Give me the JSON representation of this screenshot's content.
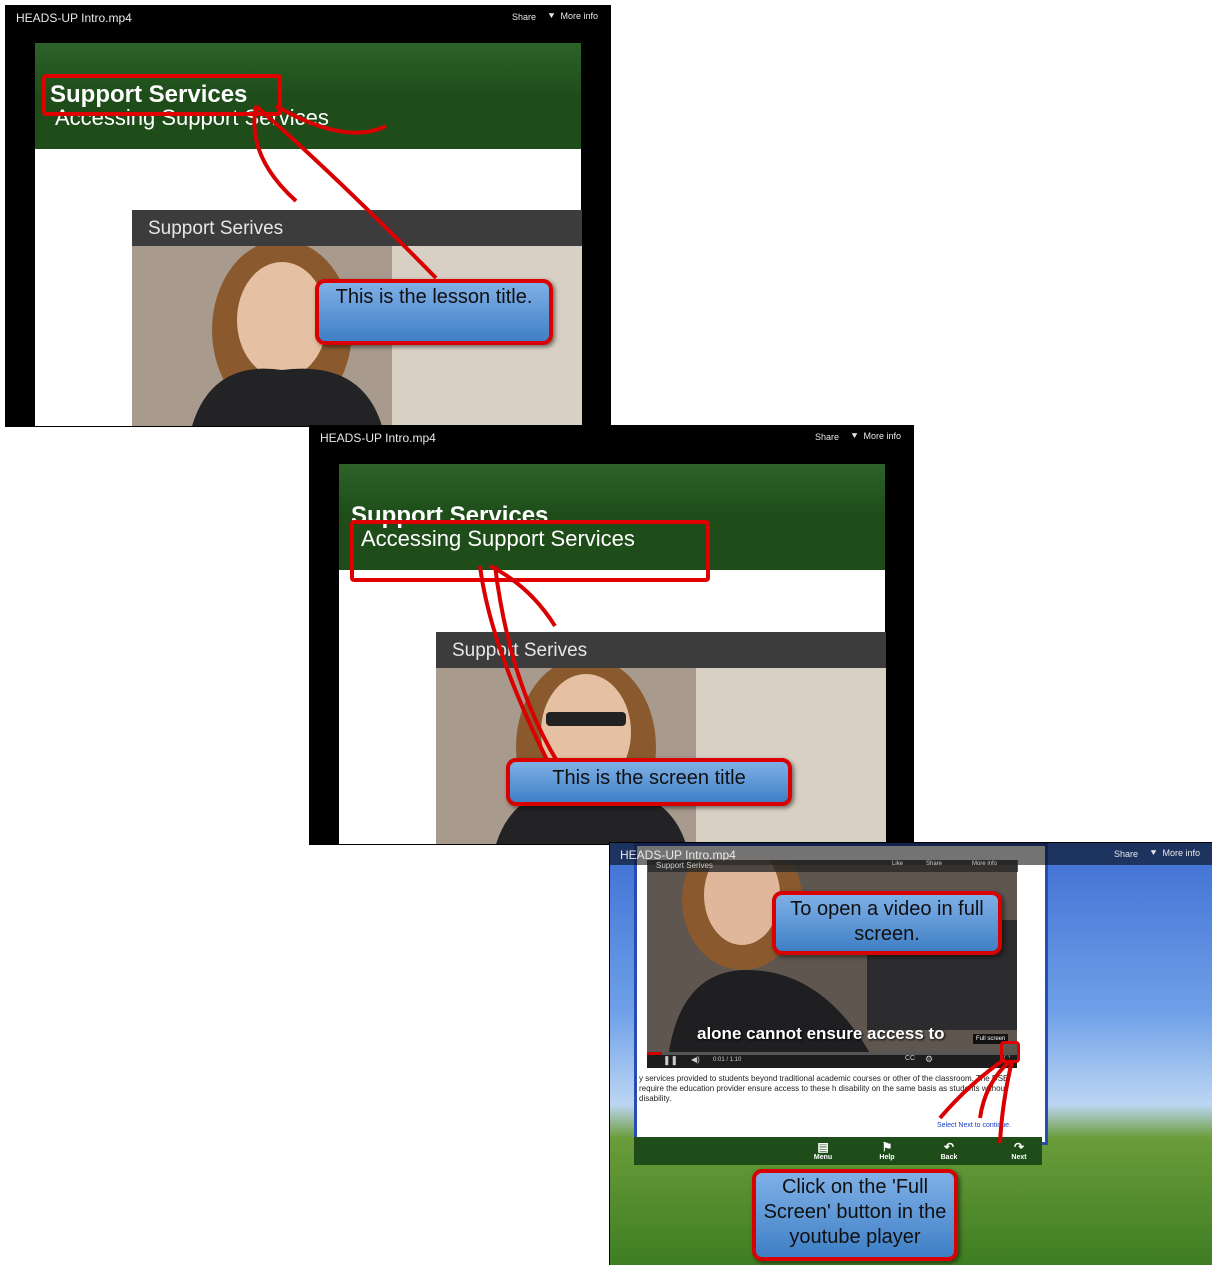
{
  "player": {
    "file_title": "HEADS-UP Intro.mp4",
    "share_label": "Share",
    "more_info_label": "More info"
  },
  "slide": {
    "lesson_title": "Support Services",
    "screen_title": "Accessing Support Services",
    "video_title": "Support Serives"
  },
  "callouts": {
    "lesson": "This is the lesson title.",
    "screen": "This is the screen title",
    "open_fullscreen": "To open a video in full screen.",
    "click_fullscreen": "Click on the 'Full Screen' button in the youtube player"
  },
  "youtube": {
    "video_title": "Support Serives",
    "like_label": "Like",
    "share_label": "Share",
    "more_info_label": "More info",
    "subtitle": "alone cannot ensure access to",
    "time": "0:01 / 1:10",
    "fullscreen_tooltip": "Full screen"
  },
  "course": {
    "body_text": "y services provided to students beyond traditional academic courses or other of the classroom. The DSE require the education provider ensure access to these h disability on the same basis as students without disability.",
    "select_next": "Select Next to continue.",
    "nav": {
      "menu": "Menu",
      "help": "Help",
      "back": "Back",
      "next": "Next"
    }
  },
  "icons": {
    "more_info": "triangle-down-icon",
    "pause": "pause-icon",
    "volume": "volume-icon",
    "captions": "cc-icon",
    "settings": "gear-icon",
    "fullscreen": "fullscreen-icon"
  }
}
